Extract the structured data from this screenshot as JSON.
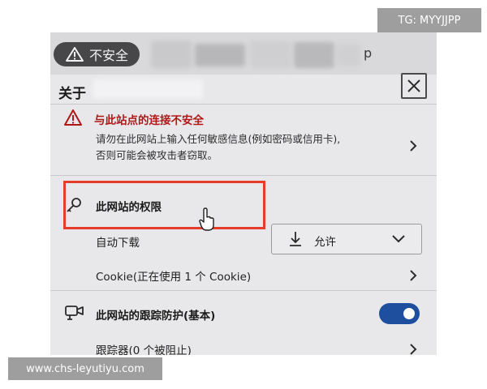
{
  "address_bar": {
    "security_label": "不安全",
    "url_visible_tail": "p"
  },
  "site_info": {
    "title": "关于",
    "close_icon": "close-icon",
    "connection": {
      "title": "与此站点的连接不安全",
      "description_line1": "请勿在此网站上输入任何敏感信息(例如密码或信用卡),",
      "description_line2": "否则可能会被攻击者窃取。",
      "warning_color": "#b01818"
    },
    "permissions": {
      "label": "此网站的权限",
      "auto_download": {
        "label": "自动下载",
        "selected": "允许"
      },
      "cookie": {
        "label": "Cookie(正在使用 1 个 Cookie)"
      }
    },
    "tracking_prevention": {
      "label": "此网站的跟踪防护(基本)",
      "enabled": true,
      "toggle_color": "#1d4f9e"
    },
    "trackers": {
      "label": "跟踪器(0 个被阻止)"
    }
  },
  "highlight_color": "#e53d2c",
  "watermarks": {
    "top_right": "TG: MYYJJPP",
    "bottom_left": "www.chs-leyutiyu.com"
  }
}
